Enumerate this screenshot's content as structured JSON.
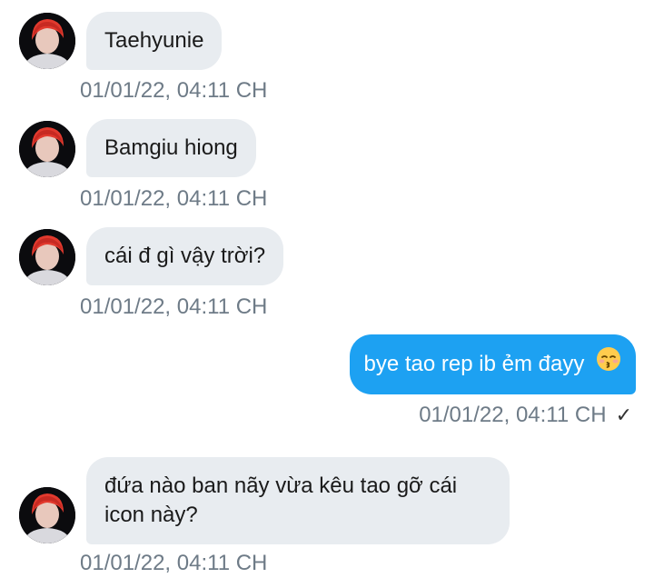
{
  "messages": [
    {
      "direction": "incoming",
      "text": "Taehyunie",
      "timestamp": "01/01/22, 04:11 CH"
    },
    {
      "direction": "incoming",
      "text": "Bamgiu hiong",
      "timestamp": "01/01/22, 04:11 CH"
    },
    {
      "direction": "incoming",
      "text": "cái đ gì vậy trời?",
      "timestamp": "01/01/22, 04:11 CH"
    },
    {
      "direction": "outgoing",
      "text": "bye tao rep ib ẻm đayy",
      "emoji": "kissing-face-with-closed-eyes",
      "timestamp": "01/01/22, 04:11 CH",
      "status": "✓"
    },
    {
      "direction": "incoming",
      "text_line1": "đứa nào ban nãy vừa kêu tao gỡ cái",
      "text_line2": "icon này?",
      "timestamp": "01/01/22, 04:11 CH"
    }
  ],
  "colors": {
    "incoming_bubble": "#e8ecf0",
    "outgoing_bubble": "#1da1f2",
    "timestamp": "#6e7b87"
  }
}
